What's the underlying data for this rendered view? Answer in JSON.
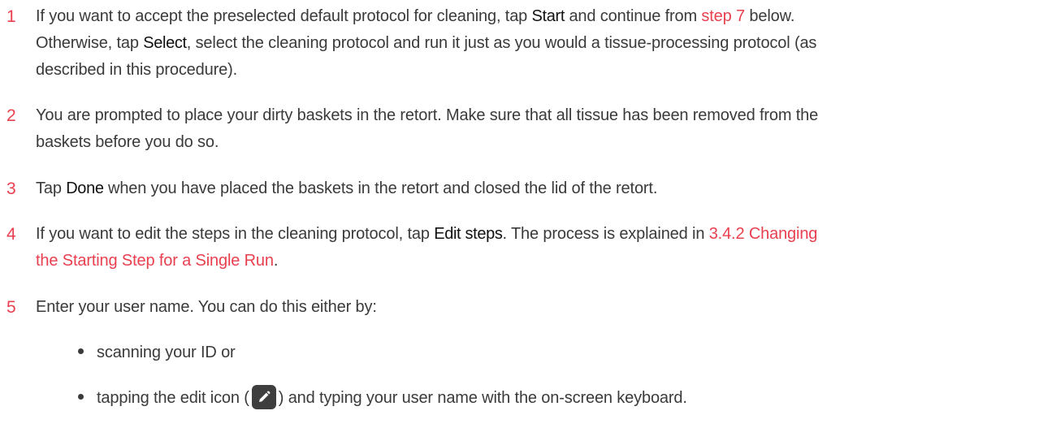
{
  "steps": [
    {
      "number": "1",
      "line1_a": "If you want to accept the preselected default protocol for cleaning, tap ",
      "line1_b": "Start",
      "line1_c": " and continue from ",
      "line1_link": "step 7",
      "line1_d": " below.",
      "line2_a": "Otherwise, tap ",
      "line2_b": "Select",
      "line2_c": ", select the cleaning protocol and run it just as you would a tissue-processing protocol (as",
      "line3": "described in this procedure)."
    },
    {
      "number": "2",
      "line1": "You are prompted to place your dirty baskets in the retort. Make sure that all tissue has been removed from the",
      "line2": "baskets before you do so."
    },
    {
      "number": "3",
      "line1_a": "Tap ",
      "line1_b": "Done",
      "line1_c": " when you have placed the baskets in the retort and closed the lid of the retort."
    },
    {
      "number": "4",
      "line1_a": "If you want to edit the steps in the cleaning protocol, tap ",
      "line1_b": "Edit steps",
      "line1_c": ". The process is explained in ",
      "line1_link": "3.4.2 Changing",
      "line2_link": "the Starting Step for a Single Run",
      "line2_c": "."
    },
    {
      "number": "5",
      "line1": "Enter your user name. You can do this either by:",
      "bullets": {
        "b1": "scanning your ID or",
        "b2_a": "tapping the edit icon (",
        "b2_b": ") and typing your user name with the on-screen keyboard."
      }
    }
  ],
  "icons": {
    "edit_icon": "pencil-icon",
    "accent_color": "#e8404f"
  }
}
